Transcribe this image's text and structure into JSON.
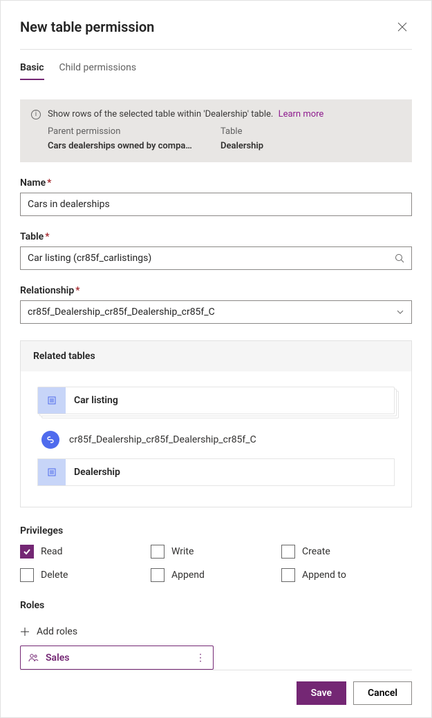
{
  "header": {
    "title": "New table permission"
  },
  "tabs": {
    "basic": "Basic",
    "child": "Child permissions"
  },
  "callout": {
    "text": "Show rows of the selected table within 'Dealership' table.",
    "learn_more": "Learn more",
    "parent_permission_label": "Parent permission",
    "table_label": "Table",
    "parent_permission_value": "Cars dealerships owned by compa…",
    "table_value": "Dealership"
  },
  "fields": {
    "name_label": "Name",
    "name_value": "Cars in dealerships",
    "table_label": "Table",
    "table_value": "Car listing (cr85f_carlistings)",
    "relationship_label": "Relationship",
    "relationship_value": "cr85f_Dealership_cr85f_Dealership_cr85f_C"
  },
  "related": {
    "header": "Related tables",
    "card1": "Car listing",
    "link": "cr85f_Dealership_cr85f_Dealership_cr85f_C",
    "card2": "Dealership"
  },
  "privileges": {
    "title": "Privileges",
    "read": "Read",
    "write": "Write",
    "create": "Create",
    "delete": "Delete",
    "append": "Append",
    "append_to": "Append to"
  },
  "roles": {
    "title": "Roles",
    "add": "Add roles",
    "items": [
      {
        "label": "Sales"
      }
    ]
  },
  "footer": {
    "save": "Save",
    "cancel": "Cancel"
  }
}
